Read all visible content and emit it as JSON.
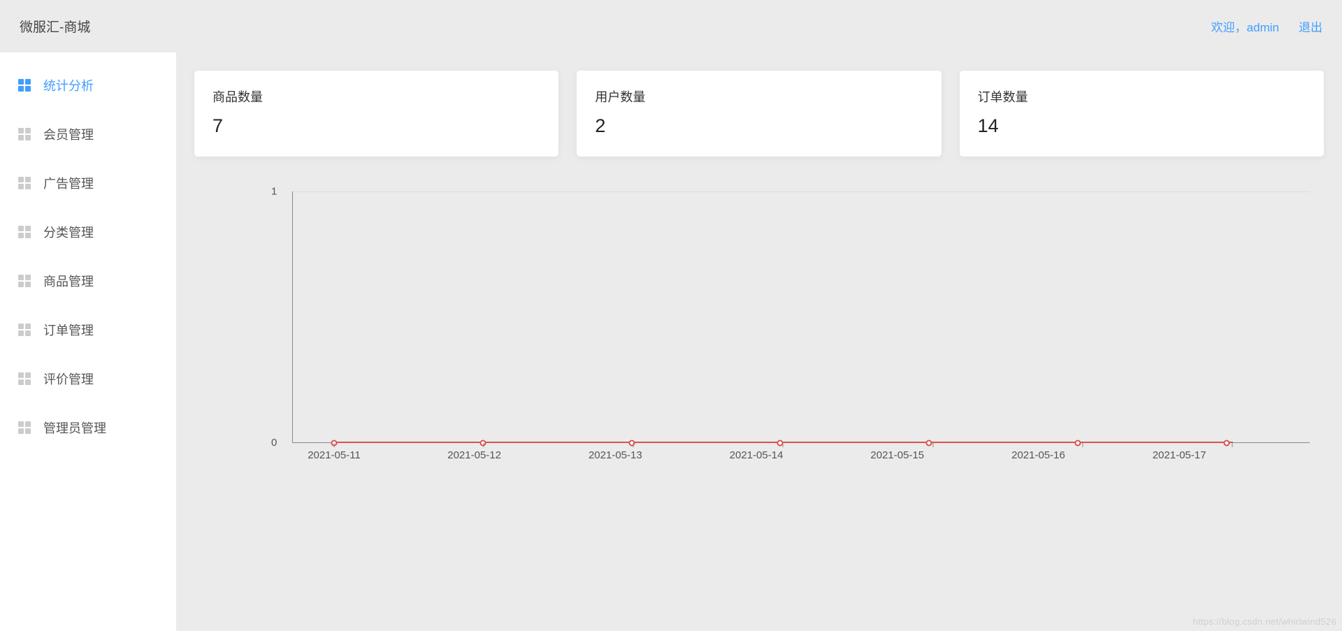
{
  "header": {
    "title": "微服汇-商城",
    "welcome": "欢迎，admin",
    "logout": "退出"
  },
  "sidebar": {
    "items": [
      {
        "label": "统计分析",
        "active": true
      },
      {
        "label": "会员管理",
        "active": false
      },
      {
        "label": "广告管理",
        "active": false
      },
      {
        "label": "分类管理",
        "active": false
      },
      {
        "label": "商品管理",
        "active": false
      },
      {
        "label": "订单管理",
        "active": false
      },
      {
        "label": "评价管理",
        "active": false
      },
      {
        "label": "管理员管理",
        "active": false
      }
    ]
  },
  "stats": {
    "cards": [
      {
        "title": "商品数量",
        "value": "7"
      },
      {
        "title": "用户数量",
        "value": "2"
      },
      {
        "title": "订单数量",
        "value": "14"
      }
    ]
  },
  "chart_data": {
    "type": "line",
    "categories": [
      "2021-05-11",
      "2021-05-12",
      "2021-05-13",
      "2021-05-14",
      "2021-05-15",
      "2021-05-16",
      "2021-05-17"
    ],
    "values": [
      0,
      0,
      0,
      0,
      0,
      0,
      0
    ],
    "title": "",
    "xlabel": "",
    "ylabel": "",
    "ylim": [
      0,
      1
    ],
    "yticks": [
      0,
      1
    ],
    "series_color": "#d9534f"
  },
  "watermark": "https://blog.csdn.net/whirlwind526"
}
